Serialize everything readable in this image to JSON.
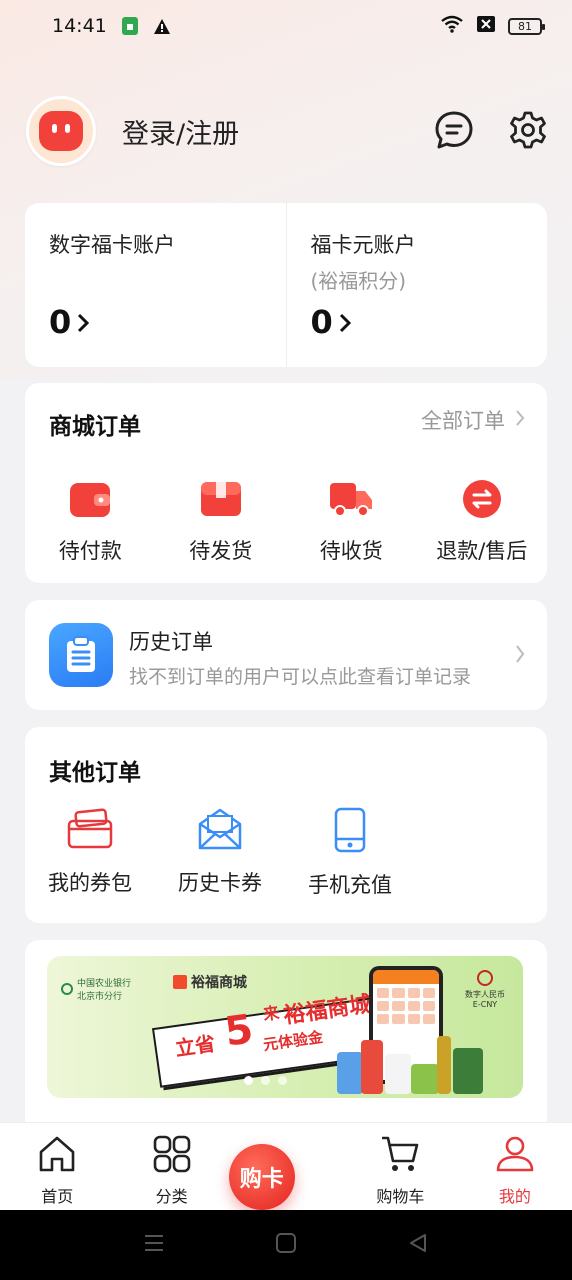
{
  "status_bar": {
    "time": "14:41",
    "battery": "81"
  },
  "header": {
    "login_label": "登录/注册"
  },
  "accounts": [
    {
      "title": "数字福卡账户",
      "subtitle": "",
      "value": "0"
    },
    {
      "title": "福卡元账户",
      "subtitle": "(裕福积分)",
      "value": "0"
    }
  ],
  "mall_orders": {
    "title": "商城订单",
    "all_label": "全部订单",
    "items": [
      {
        "label": "待付款",
        "icon": "wallet-icon"
      },
      {
        "label": "待发货",
        "icon": "box-icon"
      },
      {
        "label": "待收货",
        "icon": "truck-icon"
      },
      {
        "label": "退款/售后",
        "icon": "refund-icon"
      }
    ]
  },
  "history": {
    "title": "历史订单",
    "subtitle": "找不到订单的用户可以点此查看订单记录"
  },
  "other_orders": {
    "title": "其他订单",
    "items": [
      {
        "label": "我的券包",
        "icon": "coupon-wallet-icon"
      },
      {
        "label": "历史卡券",
        "icon": "envelope-icon"
      },
      {
        "label": "手机充值",
        "icon": "phone-icon"
      }
    ]
  },
  "banner": {
    "bank_name": "中国农业银行",
    "bank_branch": "北京市分行",
    "mall_name": "裕福商城",
    "ecny_label": "数字人民币",
    "ecny_sub": "E-CNY",
    "promo_save": "立省",
    "promo_amount": "5",
    "promo_come": "来",
    "promo_mall": "裕福商城",
    "promo_suffix": "元体验金",
    "slide_count": 3,
    "active_slide": 1
  },
  "tab_bar": {
    "home": "首页",
    "category": "分类",
    "buy": "购卡",
    "cart": "购物车",
    "mine": "我的",
    "active": "mine"
  },
  "colors": {
    "accent": "#e5393b",
    "history_icon_bg": "#2a7cf4",
    "muted_text": "#999999"
  }
}
